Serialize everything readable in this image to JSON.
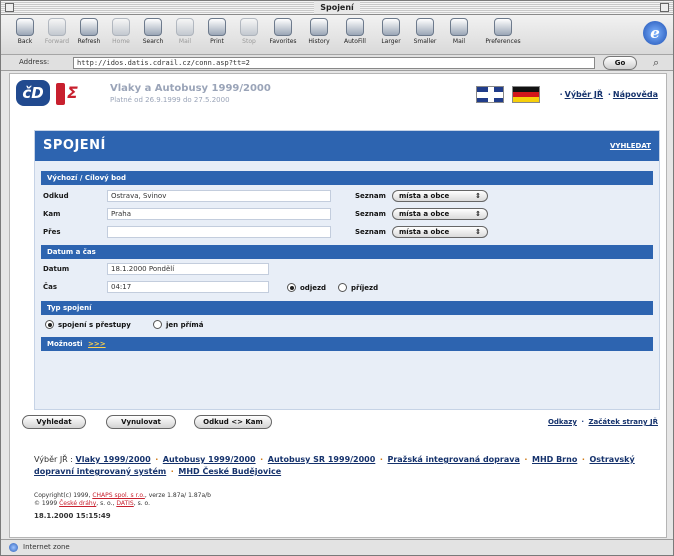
{
  "window": {
    "title": "Spojení"
  },
  "toolbar": {
    "buttons": [
      {
        "label": "Back",
        "enabled": true
      },
      {
        "label": "Forward",
        "enabled": false
      },
      {
        "label": "Refresh",
        "enabled": true
      },
      {
        "label": "Home",
        "enabled": false
      },
      {
        "label": "Search",
        "enabled": true
      },
      {
        "label": "Mail",
        "enabled": false
      },
      {
        "label": "Print",
        "enabled": true
      },
      {
        "label": "Stop",
        "enabled": false
      },
      {
        "label": "Favorites",
        "enabled": true
      },
      {
        "label": "History",
        "enabled": true
      },
      {
        "label": "AutoFill",
        "enabled": true
      },
      {
        "label": "Larger",
        "enabled": true
      },
      {
        "label": "Smaller",
        "enabled": true
      },
      {
        "label": "Mail",
        "enabled": true
      },
      {
        "label": "Preferences",
        "enabled": true
      }
    ]
  },
  "address": {
    "label": "Address:",
    "url": "http://idos.datis.cdrail.cz/conn.asp?tt=2",
    "go": "Go"
  },
  "header": {
    "title": "Vlaky a Autobusy 1999/2000",
    "subtitle": "Platné od 26.9.1999 do 27.5.2000",
    "links": [
      "Výběr JŘ",
      "Nápověda"
    ]
  },
  "panel": {
    "title": "SPOJENÍ",
    "action_link": "VYHLEDAT",
    "section_route": "Výchozí / Cílový bod",
    "from": {
      "label": "Odkud",
      "value": "Ostrava, Svinov",
      "sn_label": "Seznam",
      "sn_value": "místa a obce"
    },
    "to": {
      "label": "Kam",
      "value": "Praha",
      "sn_label": "Seznam",
      "sn_value": "místa a obce"
    },
    "via": {
      "label": "Přes",
      "value": "",
      "sn_label": "Seznam",
      "sn_value": "místa a obce"
    },
    "section_datetime": "Datum a čas",
    "date": {
      "label": "Datum",
      "value": "18.1.2000 Pondělí"
    },
    "time": {
      "label": "Čas",
      "value": "04:17"
    },
    "time_mode": {
      "depart": "odjezd",
      "arrive": "příjezd",
      "selected": "depart"
    },
    "section_type": "Typ spojení",
    "conn_type": {
      "with_transfers": "spojení s přestupy",
      "direct": "jen přímá",
      "selected": "with_transfers"
    },
    "section_options": "Možnosti",
    "options_link": ">>>"
  },
  "buttons": {
    "search": "Vyhledat",
    "clear": "Vynulovat",
    "swap": "Odkud <> Kam"
  },
  "bottom_links": [
    "Odkazy",
    "Začátek strany JŘ"
  ],
  "footer": {
    "prefix": "Výběr JŘ :",
    "links": [
      "Vlaky 1999/2000",
      "Autobusy 1999/2000",
      "Autobusy SR 1999/2000",
      "Pražská integrovaná doprava",
      "MHD Brno",
      "Ostravský dopravní integrovaný systém",
      "MHD České Budějovice"
    ],
    "copyright_1a": "Copyright(c) 1999,",
    "copyright_1b": "CHAPS spol. s r.o.",
    "copyright_1c": ", verze 1.87a/ 1.87a/b",
    "copyright_2a": "© 1999",
    "copyright_2b": "České dráhy",
    "copyright_2c": ", s. o.,",
    "copyright_2d": "DATIS",
    "copyright_2e": ", s. o.",
    "timestamp": "18.1.2000 15:15:49"
  },
  "status": {
    "text": "Internet zone"
  }
}
